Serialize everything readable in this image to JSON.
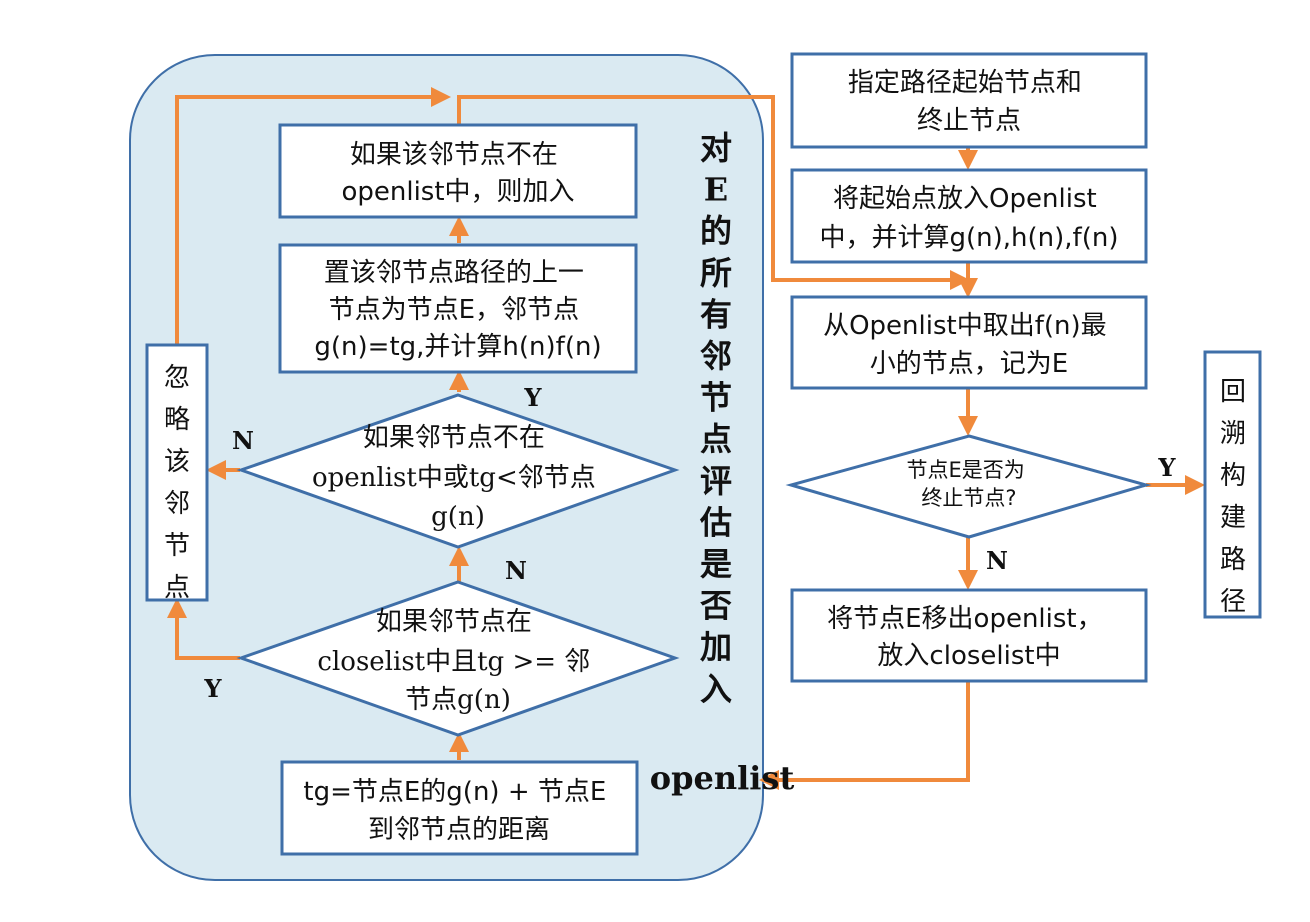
{
  "colors": {
    "box_border": "#3f6fa8",
    "arrow": "#f08a3c",
    "region_fill": "#daeaf2",
    "region_border": "#3f6fa8"
  },
  "right_flow": {
    "start": [
      "指定路径起始节点和",
      "终止节点"
    ],
    "put_start": [
      "将起始点放入Openlist",
      "中，并计算g(n),h(n),f(n)"
    ],
    "take_min": [
      "从Openlist中取出f(n)最",
      "小的节点，记为E"
    ],
    "is_end": [
      "节点E是否为",
      "终止节点?"
    ],
    "move_closed": [
      "将节点E移出openlist，",
      "放入closelist中"
    ],
    "backtrack": "回溯构建路径"
  },
  "left_loop": {
    "add_open": [
      "如果该邻节点不在",
      "openlist中，则加入"
    ],
    "set_parent": [
      "置该邻节点路径的上一",
      "节点为节点E，邻节点",
      "g(n)=tg,并计算h(n)f(n)"
    ],
    "cond_open": [
      "如果邻节点不在",
      "openlist中或tg<邻节点",
      "g(n)"
    ],
    "cond_closed": [
      "如果邻节点在",
      "closelist中且tg >= 邻",
      "节点g(n)"
    ],
    "compute_tg": [
      "tg=节点E的g(n) + 节点E",
      "到邻节点的距离"
    ],
    "ignore": "忽略该邻节点",
    "region_title_chars": "对E的所有邻节点评估是否加入",
    "region_title_tail": "openlist"
  },
  "labels": {
    "yes": "Y",
    "no": "N"
  }
}
